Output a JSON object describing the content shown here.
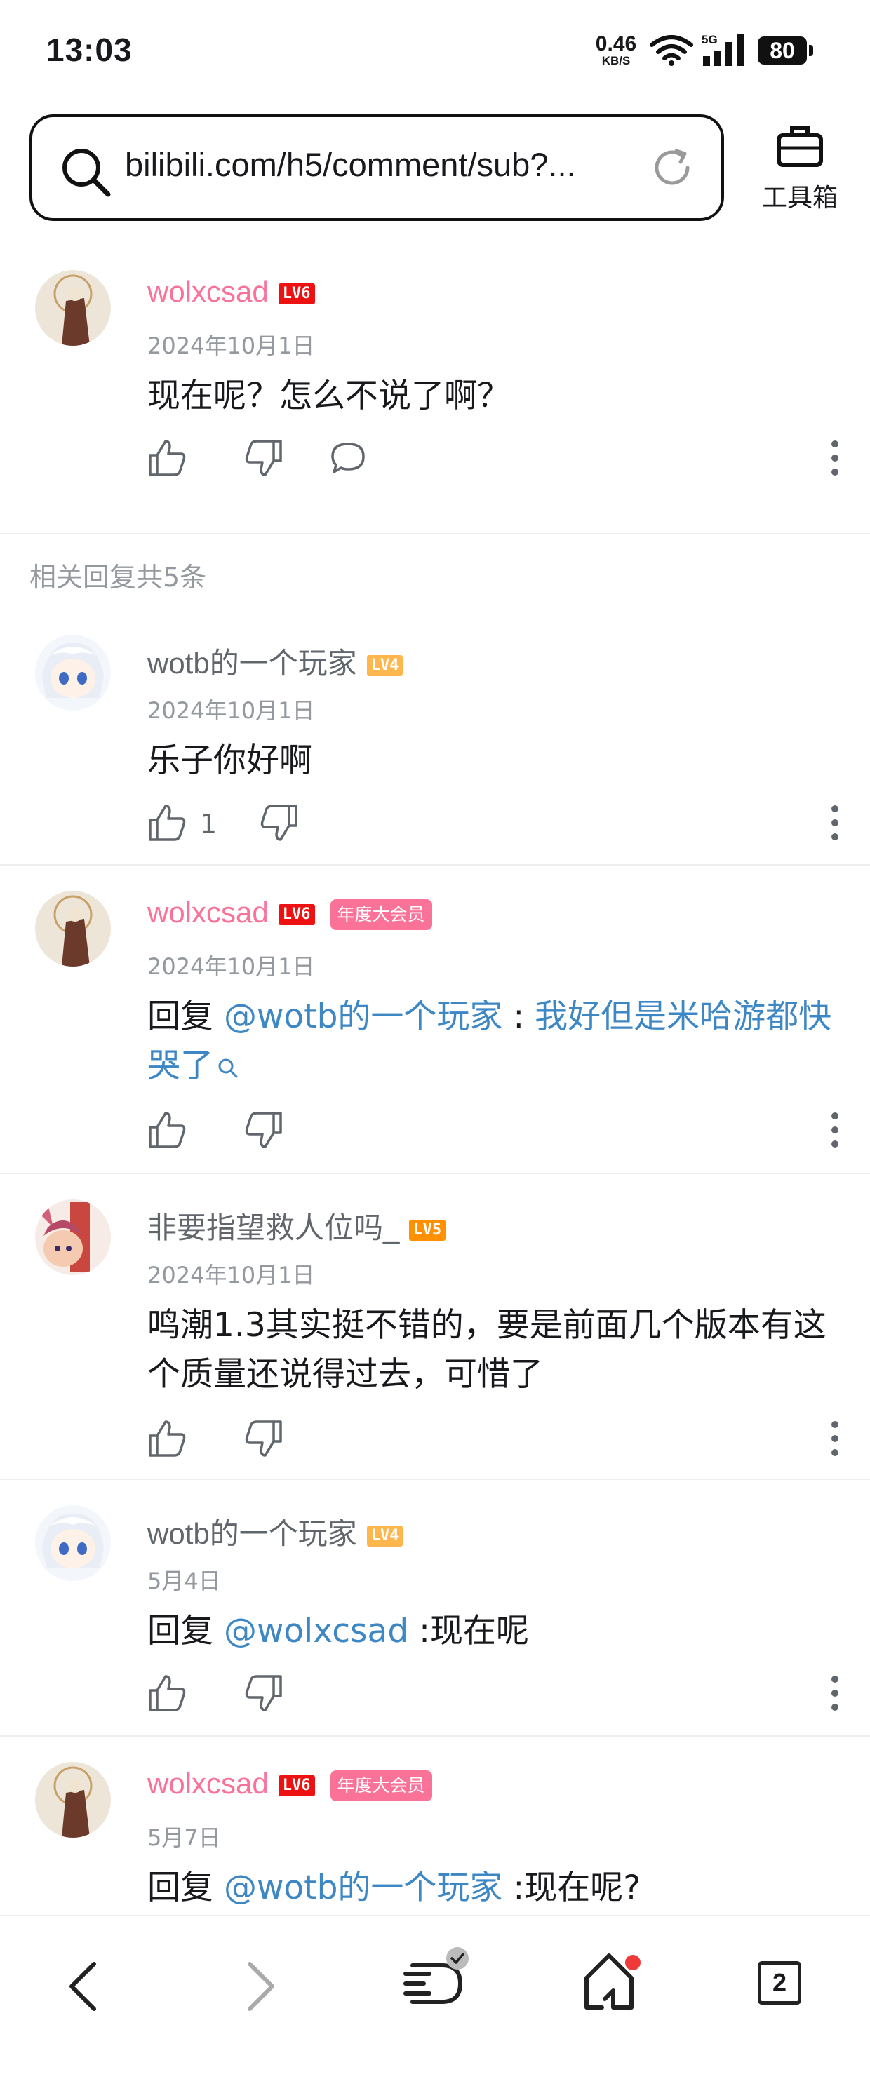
{
  "status_bar": {
    "time": "13:03",
    "net_speed": "0.46",
    "net_unit": "KB/S",
    "signal_label": "5G",
    "battery": "80"
  },
  "address_bar": {
    "url": "bilibili.com/h5/comment/sub?..."
  },
  "toolbox": {
    "label": "工具箱"
  },
  "main_comment": {
    "username": "wolxcsad",
    "level": "LV6",
    "date": "2024年10月1日",
    "text": "现在呢？怎么不说了啊？"
  },
  "related_header": "相关回复共5条",
  "replies": [
    {
      "username": "wotb的一个玩家",
      "level": "LV4",
      "date": "2024年10月1日",
      "text": "乐子你好啊",
      "like_count": "1"
    },
    {
      "username": "wolxcsad",
      "level": "LV6",
      "badge": "年度大会员",
      "date": "2024年10月1日",
      "reply_prefix": "回复 ",
      "mention": "@wotb的一个玩家",
      "separator": " : ",
      "text_link": "我好但是米哈游都快哭了"
    },
    {
      "username": "非要指望救人位吗_",
      "level": "LV5",
      "date": "2024年10月1日",
      "text": "鸣潮1.3其实挺不错的，要是前面几个版本有这个质量还说得过去，可惜了"
    },
    {
      "username": "wotb的一个玩家",
      "level": "LV4",
      "date": "5月4日",
      "reply_prefix": "回复 ",
      "mention": "@wolxcsad",
      "text": " :现在呢"
    },
    {
      "username": "wolxcsad",
      "level": "LV6",
      "badge": "年度大会员",
      "date": "5月7日",
      "reply_prefix": "回复 ",
      "mention": "@wotb的一个玩家",
      "text": " :现在呢?"
    }
  ],
  "bottom_nav": {
    "tab_count": "2"
  },
  "colors": {
    "username_pink": "#fb7299",
    "mention_blue": "#3e87c5",
    "secondary_gray": "#9499a0"
  }
}
